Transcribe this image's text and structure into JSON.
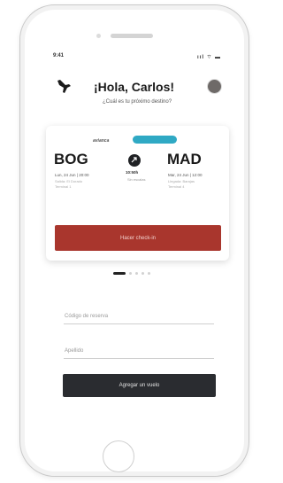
{
  "status_bar": {
    "time": "9:41",
    "icons": "ııl ⌔ ▬"
  },
  "header": {
    "greeting": "¡Hola, Carlos!",
    "subtitle": "¿Cuál es tu próximo destino?"
  },
  "flight_card": {
    "airline": "avianca",
    "origin": {
      "code": "BOG",
      "date": "Lun, 24 Jun | 20:00",
      "terminal": "Salida: El Dorado\nTerminal 1"
    },
    "destination": {
      "code": "MAD",
      "date": "Mar, 24 Jun | 12:00",
      "terminal": "Llegada: Barajas\nTerminal 4"
    },
    "duration": "10:50h",
    "stops": "Sin escalas",
    "checkin_label": "Hacer check-in"
  },
  "pager": {
    "count": 5,
    "active_index": 0
  },
  "form": {
    "booking_code_placeholder": "Código de reserva",
    "surname_placeholder": "Apellido",
    "add_flight_label": "Agregar un vuelo"
  },
  "colors": {
    "checkin_button": "#a9362d",
    "add_flight_button": "#2a2c30",
    "airline_pill": "#2fa9c4"
  }
}
